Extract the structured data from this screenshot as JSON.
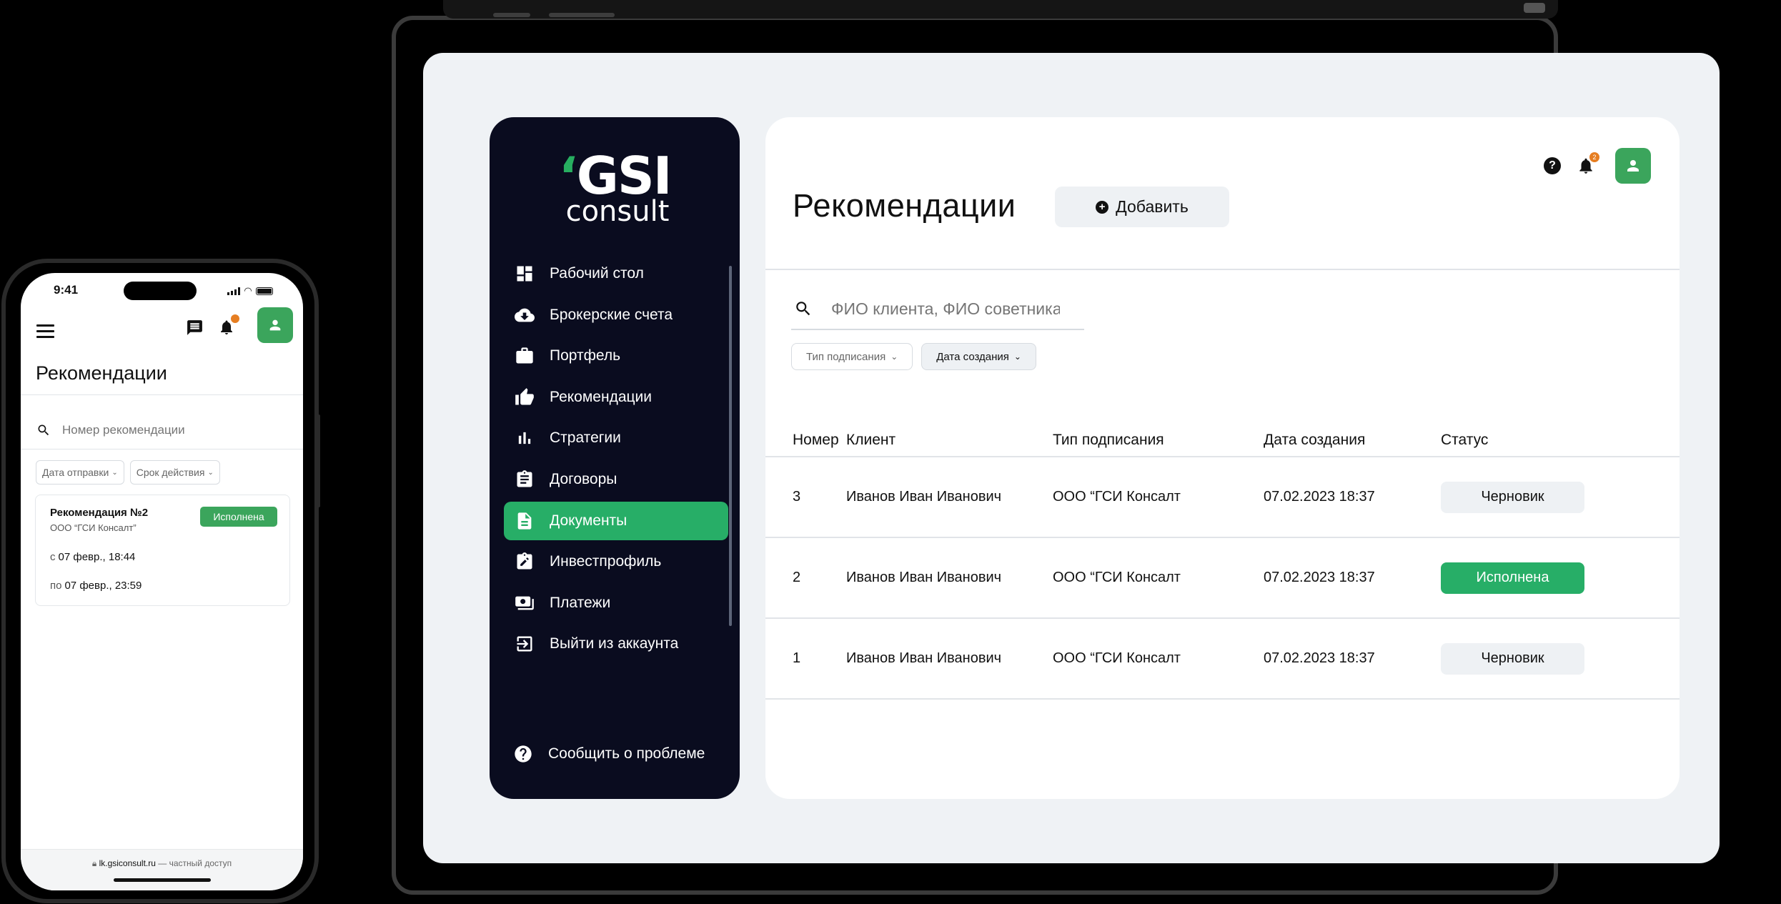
{
  "brand": {
    "logo_main": "GSI",
    "logo_sub": "consult",
    "accent_color": "#27ae67"
  },
  "sidebar": {
    "items": [
      {
        "label": "Рабочий стол",
        "icon": "dashboard-icon",
        "active": false
      },
      {
        "label": "Брокерские счета",
        "icon": "cloud-download-icon",
        "active": false
      },
      {
        "label": "Портфель",
        "icon": "briefcase-icon",
        "active": false
      },
      {
        "label": "Рекомендации",
        "icon": "thumbs-up-icon",
        "active": false
      },
      {
        "label": "Стратегии",
        "icon": "bar-chart-icon",
        "active": false
      },
      {
        "label": "Договоры",
        "icon": "clipboard-icon",
        "active": false
      },
      {
        "label": "Документы",
        "icon": "document-icon",
        "active": true
      },
      {
        "label": "Инвестпрофиль",
        "icon": "edit-clipboard-icon",
        "active": false
      },
      {
        "label": "Платежи",
        "icon": "payments-icon",
        "active": false
      },
      {
        "label": "Выйти из аккаунта",
        "icon": "logout-icon",
        "active": false
      }
    ],
    "report_label": "Сообщить о проблеме"
  },
  "header": {
    "title": "Рекомендации",
    "add_label": "Добавить",
    "notifications_count": "2"
  },
  "search": {
    "placeholder": "ФИО клиента, ФИО советника"
  },
  "filters": [
    {
      "label": "Тип подписания",
      "selected": false
    },
    {
      "label": "Дата создания",
      "selected": true
    }
  ],
  "table": {
    "columns": [
      "Номер",
      "Клиент",
      "Тип подписания",
      "Дата создания",
      "Статус"
    ],
    "rows": [
      {
        "number": "3",
        "client": "Иванов Иван Иванович",
        "sign_type": "ООО “ГСИ Консалт",
        "created": "07.02.2023 18:37",
        "status": "Черновик",
        "status_kind": "draft"
      },
      {
        "number": "2",
        "client": "Иванов Иван Иванович",
        "sign_type": "ООО “ГСИ Консалт",
        "created": "07.02.2023 18:37",
        "status": "Исполнена",
        "status_kind": "done"
      },
      {
        "number": "1",
        "client": "Иванов Иван Иванович",
        "sign_type": "ООО “ГСИ Консалт",
        "created": "07.02.2023 18:37",
        "status": "Черновик",
        "status_kind": "draft"
      }
    ]
  },
  "mobile": {
    "time": "9:41",
    "title": "Рекомендации",
    "notifications_count": "2",
    "search_placeholder": "Номер рекомендации",
    "filters": [
      "Дата отправки",
      "Срок действия"
    ],
    "card": {
      "title": "Рекомендация №2",
      "company": "ООО “ГСИ Консалт”",
      "status": "Исполнена",
      "from_label": "с",
      "from_value": "07 февр., 18:44",
      "to_label": "по",
      "to_value": "07 февр., 23:59"
    },
    "url": "lk.gsiconsult.ru",
    "url_suffix": "— частный доступ"
  }
}
